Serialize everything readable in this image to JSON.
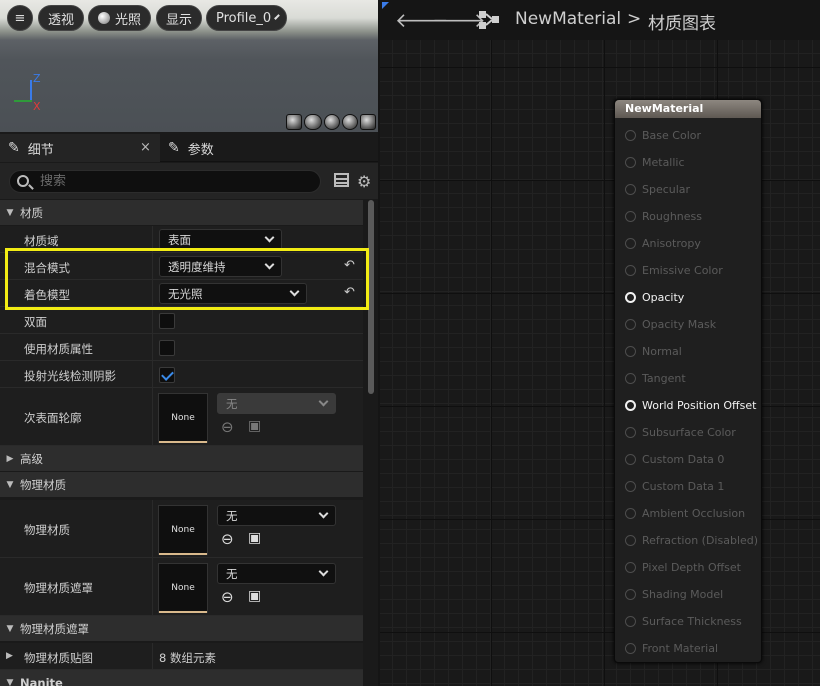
{
  "viewport": {
    "menu_icon": "≡",
    "perspective_label": "透视",
    "lighting_label": "光照",
    "show_label": "显示",
    "profile_label": "Profile_0",
    "axis_z": "Z",
    "axis_x": "X"
  },
  "tabs": {
    "details_label": "细节",
    "close_glyph": "×",
    "params_label": "参数"
  },
  "search": {
    "placeholder": "搜索"
  },
  "sections": {
    "material": "材质",
    "advanced": "高级",
    "physmat": "物理材质",
    "physmask": "物理材质遮罩",
    "nanite": "Nanite"
  },
  "props": {
    "domain_label": "材质域",
    "domain_value": "表面",
    "blend_label": "混合模式",
    "blend_value": "透明度维持",
    "shading_label": "着色模型",
    "shading_value": "无光照",
    "twosided_label": "双面",
    "twosided_checked": false,
    "usemat_label": "使用材质属性",
    "usemat_checked": false,
    "raytrace_label": "投射光线检测阴影",
    "raytrace_checked": true,
    "subsurface_label": "次表面轮廓",
    "subsurface_thumb": "None",
    "subsurface_value": "无",
    "physmat_label": "物理材质",
    "physmat_thumb": "None",
    "physmat_value": "无",
    "physmask_label": "物理材质遮罩",
    "physmask_thumb": "None",
    "physmask_value": "无",
    "physmap_label": "物理材质贴图",
    "physmap_value": "8 数组元素"
  },
  "graph": {
    "crumb_material": "NewMaterial",
    "crumb_sep": ">",
    "crumb_graph": "材质图表",
    "node_title": "NewMaterial",
    "pins": [
      {
        "label": "Base Color",
        "active": false
      },
      {
        "label": "Metallic",
        "active": false
      },
      {
        "label": "Specular",
        "active": false
      },
      {
        "label": "Roughness",
        "active": false
      },
      {
        "label": "Anisotropy",
        "active": false
      },
      {
        "label": "Emissive Color",
        "active": false
      },
      {
        "label": "Opacity",
        "active": true
      },
      {
        "label": "Opacity Mask",
        "active": false
      },
      {
        "label": "Normal",
        "active": false
      },
      {
        "label": "Tangent",
        "active": false
      },
      {
        "label": "World Position Offset",
        "active": true
      },
      {
        "label": "Subsurface Color",
        "active": false
      },
      {
        "label": "Custom Data 0",
        "active": false
      },
      {
        "label": "Custom Data 1",
        "active": false
      },
      {
        "label": "Ambient Occlusion",
        "active": false
      },
      {
        "label": "Refraction (Disabled)",
        "active": false
      },
      {
        "label": "Pixel Depth Offset",
        "active": false
      },
      {
        "label": "Shading Model",
        "active": false
      },
      {
        "label": "Surface Thickness",
        "active": false
      },
      {
        "label": "Front Material",
        "active": false
      }
    ]
  },
  "colors": {
    "highlight": "#f2ec14",
    "accent": "#3a8ae8",
    "node_header": "#8d8780"
  }
}
